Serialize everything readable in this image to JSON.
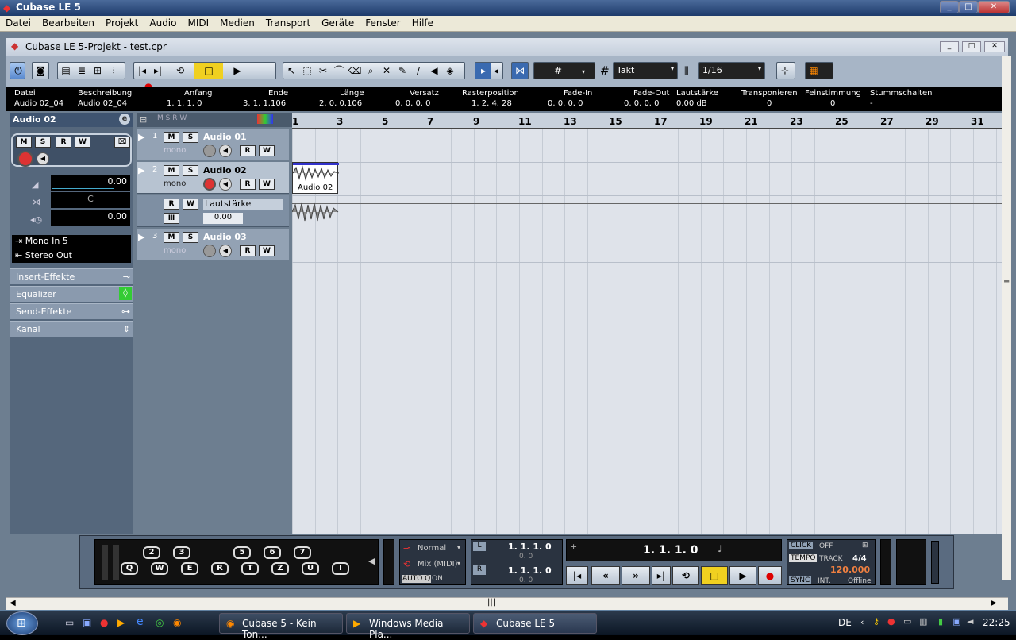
{
  "window": {
    "title": "Cubase LE 5"
  },
  "menu": [
    "Datei",
    "Bearbeiten",
    "Projekt",
    "Audio",
    "MIDI",
    "Medien",
    "Transport",
    "Geräte",
    "Fenster",
    "Hilfe"
  ],
  "project": {
    "title": "Cubase LE 5-Projekt - test.cpr"
  },
  "toolbar": {
    "quantize_grid": "Takt",
    "quantize_value": "1/16"
  },
  "infoline": {
    "headers": [
      "Datei",
      "Beschreibung",
      "Anfang",
      "Ende",
      "Länge",
      "Versatz",
      "Rasterposition",
      "Fade-In",
      "Fade-Out",
      "Lautstärke",
      "Transponieren",
      "Feinstimmung",
      "Stummschalten"
    ],
    "values": [
      "Audio 02_04",
      "Audio 02_04",
      "1. 1. 1.   0",
      "3. 1. 1.106",
      "2. 0. 0.106",
      "0. 0. 0.   0",
      "1. 2. 4. 28",
      "0. 0. 0.   0",
      "0. 0. 0.   0",
      "0.00 dB",
      "0",
      "0",
      "-"
    ]
  },
  "inspector": {
    "title": "Audio 02",
    "volume": "0.00",
    "pan": "C",
    "delay": "0.00",
    "input": "Mono In 5",
    "output": "Stereo Out",
    "sections": [
      "Insert-Effekte",
      "Equalizer",
      "Send-Effekte",
      "Kanal"
    ]
  },
  "tracks": [
    {
      "num": "1",
      "name": "Audio 01",
      "type": "mono"
    },
    {
      "num": "2",
      "name": "Audio 02",
      "type": "mono"
    },
    {
      "num": "3",
      "name": "Audio 03",
      "type": "mono"
    }
  ],
  "automation": {
    "label": "Lautstärke",
    "value": "0.00"
  },
  "ruler": [
    "1",
    "3",
    "5",
    "7",
    "9",
    "11",
    "13",
    "15",
    "17",
    "19",
    "21",
    "23",
    "25",
    "27",
    "29",
    "31"
  ],
  "event": {
    "name": "Audio 02"
  },
  "transport": {
    "keys_top": [
      "2",
      "3",
      "5",
      "6",
      "7"
    ],
    "keys_bottom": [
      "Q",
      "W",
      "E",
      "R",
      "T",
      "Z",
      "U",
      "I"
    ],
    "record_mode": "Normal",
    "cycle_mode": "Mix (MIDI)",
    "auto_q": "AUTO Q",
    "auto_q_state": "ON",
    "left_locator": "1. 1. 1.   0",
    "left_offset": "0.   0",
    "right_locator": "1. 1. 1.   0",
    "right_offset": "0.   0",
    "position": "1. 1. 1.   0",
    "click": "CLICK",
    "click_state": "OFF",
    "tempo": "TEMPO",
    "tempo_mode": "TRACK",
    "signature": "4/4",
    "tempo_value": "120.000",
    "sync": "SYNC",
    "sync_source": "INT.",
    "sync_state": "Offline"
  },
  "taskbar": {
    "tasks": [
      "Cubase 5 - Kein Ton...",
      "Windows Media Pla...",
      "Cubase LE 5"
    ],
    "lang": "DE",
    "clock": "22:25"
  }
}
